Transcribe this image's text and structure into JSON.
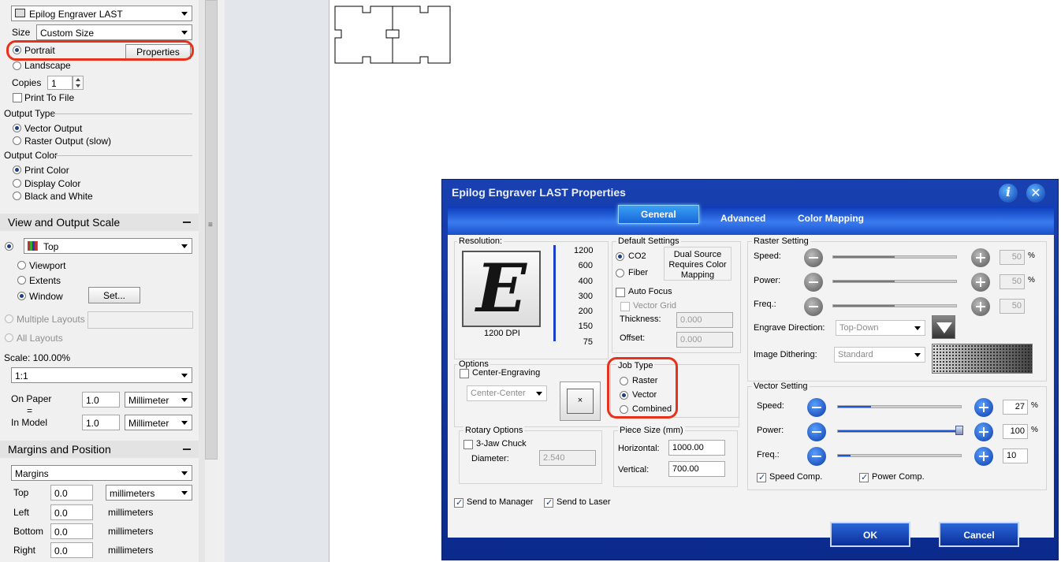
{
  "left_panel": {
    "printer_name": "Epilog Engraver LAST",
    "size_label": "Size",
    "size_value": "Custom Size",
    "portrait_label": "Portrait",
    "properties_label": "Properties",
    "landscape_label": "Landscape",
    "copies_label": "Copies",
    "copies_value": "1",
    "print_to_file_label": "Print To File",
    "output_type_label": "Output Type",
    "vector_output_label": "Vector Output",
    "raster_output_label": "Raster Output (slow)",
    "output_color_label": "Output Color",
    "print_color_label": "Print Color",
    "display_color_label": "Display Color",
    "black_white_label": "Black and White"
  },
  "view_section": {
    "title": "View and Output Scale",
    "view_value": "Top",
    "viewport_label": "Viewport",
    "extents_label": "Extents",
    "window_label": "Window",
    "set_label": "Set...",
    "multiple_layouts_label": "Multiple Layouts",
    "all_layouts_label": "All Layouts",
    "scale_label": "Scale:  100.00%",
    "scale_value": "1:1",
    "on_paper_label": "On Paper",
    "equals_label": "=",
    "in_model_label": "In Model",
    "on_paper_value": "1.0",
    "in_model_value": "1.0",
    "unit_value": "Millimeter"
  },
  "margins_section": {
    "title": "Margins and Position",
    "mode_value": "Margins",
    "rows": [
      {
        "label": "Top",
        "value": "0.0",
        "unit": "millimeters"
      },
      {
        "label": "Left",
        "value": "0.0",
        "unit": "millimeters"
      },
      {
        "label": "Bottom",
        "value": "0.0",
        "unit": "millimeters"
      },
      {
        "label": "Right",
        "value": "0.0",
        "unit": "millimeters"
      }
    ]
  },
  "dialog": {
    "title": "Epilog Engraver LAST Properties",
    "tabs": [
      "General",
      "Advanced",
      "Color Mapping"
    ],
    "resolution": {
      "label": "Resolution:",
      "letter": "E",
      "dpi_label": "1200 DPI",
      "values": [
        "1200",
        "600",
        "400",
        "300",
        "200",
        "150",
        "75"
      ]
    },
    "default_settings": {
      "label": "Default Settings",
      "co2_label": "CO2",
      "fiber_label": "Fiber",
      "dual_source_note": "Dual Source Requires Color Mapping",
      "auto_focus_label": "Auto Focus",
      "vector_grid_label": "Vector Grid",
      "thickness_label": "Thickness:",
      "thickness_value": "0.000",
      "offset_label": "Offset:",
      "offset_value": "0.000"
    },
    "options": {
      "label": "Options",
      "center_engraving_label": "Center-Engraving",
      "center_value": "Center-Center"
    },
    "job_type": {
      "label": "Job Type",
      "raster_label": "Raster",
      "vector_label": "Vector",
      "combined_label": "Combined"
    },
    "rotary": {
      "label": "Rotary Options",
      "jaw_label": "3-Jaw Chuck",
      "diameter_label": "Diameter:",
      "diameter_value": "2.540"
    },
    "piece_size": {
      "label": "Piece Size (mm)",
      "horizontal_label": "Horizontal:",
      "horizontal_value": "1000.00",
      "vertical_label": "Vertical:",
      "vertical_value": "700.00"
    },
    "raster_setting": {
      "label": "Raster Setting",
      "speed_label": "Speed:",
      "speed_value": "50",
      "speed_level": 0.5,
      "power_label": "Power:",
      "power_value": "50",
      "power_level": 0.5,
      "freq_label": "Freq.:",
      "freq_value": "50",
      "freq_level": 0.5,
      "percent": "%",
      "engrave_direction_label": "Engrave Direction:",
      "engrave_direction_value": "Top-Down",
      "dithering_label": "Image Dithering:",
      "dithering_value": "Standard"
    },
    "vector_setting": {
      "label": "Vector Setting",
      "speed_label": "Speed:",
      "speed_value": "27",
      "speed_level": 0.27,
      "power_label": "Power:",
      "power_value": "100",
      "power_level": 1.0,
      "freq_label": "Freq.:",
      "freq_value": "10",
      "freq_level": 0.1,
      "percent": "%",
      "speed_comp_label": "Speed Comp.",
      "power_comp_label": "Power Comp."
    },
    "send_to_manager_label": "Send to Manager",
    "send_to_laser_label": "Send to Laser",
    "ok_label": "OK",
    "cancel_label": "Cancel"
  },
  "colors": {
    "dialog_blue": "#0b2a8c",
    "highlight_red": "#e8311a"
  }
}
